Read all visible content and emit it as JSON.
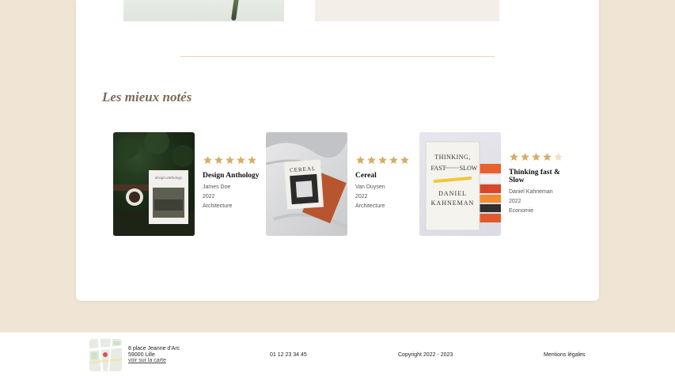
{
  "section_title": "Les mieux notés",
  "star_color": "#d7ae67",
  "star_empty_color": "#efe1c8",
  "books": [
    {
      "title": "Design Anthology",
      "author": "James Doe",
      "year": "2022",
      "category": "Architecture",
      "rating": 5,
      "cover_text": "design anthology"
    },
    {
      "title": "Cereal",
      "author": "Van Duysen",
      "year": "2022",
      "category": "Architecture",
      "rating": 5,
      "cover_text": "CEREAL"
    },
    {
      "title": "Thinking fast & Slow",
      "author": "Daniel Kahneman",
      "year": "2022",
      "category": "Economie",
      "rating": 4,
      "cover_text": {
        "line1": "THINKING,",
        "line2": "FAST",
        "line2b": "SLOW",
        "author_first": "DANIEL",
        "author_last": "KAHNEMAN"
      }
    }
  ],
  "footer": {
    "address_line1": "8 place Jeanne d'Arc",
    "address_line2": "59000 Lille",
    "map_link": "voir sur la carte",
    "phone": "01 12 23 34 45",
    "copyright": "Copyright 2022 - 2023",
    "legal": "Mentions légales"
  }
}
